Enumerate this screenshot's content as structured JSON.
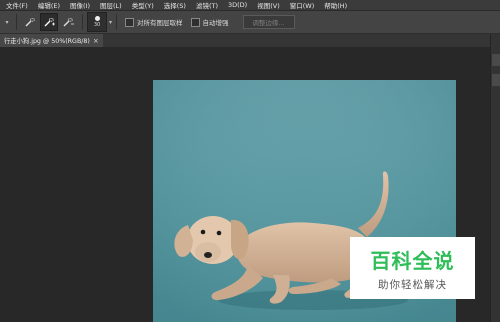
{
  "menu": [
    "文件(F)",
    "编辑(E)",
    "图像(I)",
    "图层(L)",
    "类型(Y)",
    "选择(S)",
    "滤镜(T)",
    "3D(D)",
    "视图(V)",
    "窗口(W)",
    "帮助(H)"
  ],
  "options": {
    "brush_size": "30",
    "sample_all_layers": "对所有图层取样",
    "auto_enhance": "自动增强",
    "refine_edge": "调整边缘..."
  },
  "document_tab": {
    "title": "行走小狗.jpg @ 50%(RGB/8)",
    "close": "×"
  },
  "watermark": {
    "title": "百科全说",
    "subtitle": "助你轻松解决"
  },
  "colors": {
    "background_teal": "#5e9ca5",
    "watermark_green": "#2ebd59"
  }
}
